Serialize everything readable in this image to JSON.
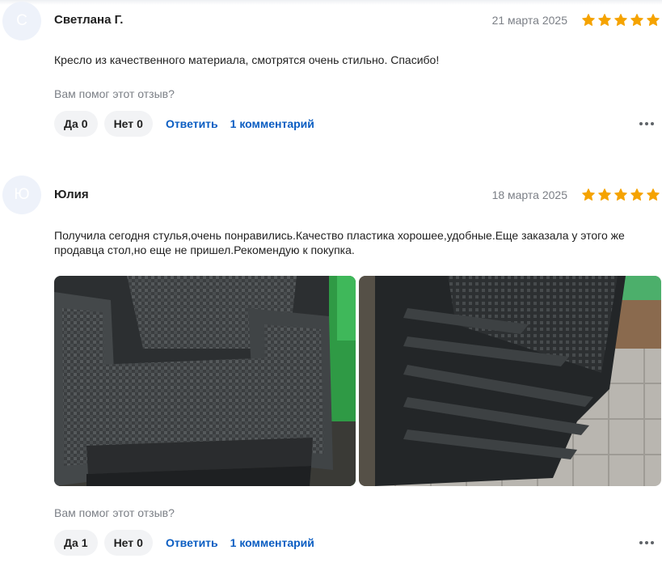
{
  "reviews": [
    {
      "avatar_letter": "С",
      "author": "Светлана Г.",
      "date": "21 марта 2025",
      "rating": 5,
      "text": "Кресло из качественного материала, смотрятся очень стильно. Спасибо!",
      "helpful_question": "Вам помог этот отзыв?",
      "yes_label": "Да",
      "yes_count": "0",
      "no_label": "Нет",
      "no_count": "0",
      "reply_label": "Ответить",
      "comments_label": "1 комментарий"
    },
    {
      "avatar_letter": "Ю",
      "author": "Юлия",
      "date": "18 марта 2025",
      "rating": 5,
      "text": "Получила сегодня стулья,очень понравились.Качество пластика хорошее,удобные.Еще заказала у этого же продавца стол,но еще не пришел.Рекомендую к покупка.",
      "photos": [
        "chair-front-photo",
        "stacked-chairs-photo"
      ],
      "helpful_question": "Вам помог этот отзыв?",
      "yes_label": "Да",
      "yes_count": "1",
      "no_label": "Нет",
      "no_count": "0",
      "reply_label": "Ответить",
      "comments_label": "1 комментарий"
    }
  ],
  "colors": {
    "star": "#f5a300",
    "link": "#0a5dc2",
    "pill_bg": "#f2f3f5",
    "muted_text": "#7b7f86",
    "avatar_bg": "#eef2fa"
  },
  "icons": {
    "star": "star-icon",
    "more": "more-dots-icon"
  }
}
